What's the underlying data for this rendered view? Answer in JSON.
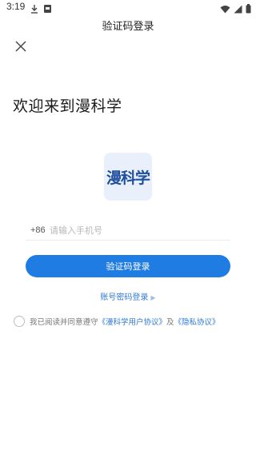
{
  "status_bar": {
    "time": "3:19"
  },
  "header": {
    "title": "验证码登录"
  },
  "welcome": "欢迎来到漫科学",
  "logo": {
    "text": "漫科学"
  },
  "phone": {
    "country_code": "+86",
    "placeholder": "请输入手机号"
  },
  "login_button": "验证码登录",
  "password_login": "账号密码登录",
  "agreement": {
    "prefix": "我已阅读并同意遵守",
    "user_agreement": "《漫科学用户协议》",
    "and": "及",
    "privacy": "《隐私协议》"
  },
  "icons": {
    "close": "close-icon",
    "download": "download-icon",
    "notification": "notification-icon",
    "wifi": "wifi-icon",
    "signal": "signal-icon",
    "battery": "battery-icon",
    "arrow": "chevron-right-icon"
  },
  "colors": {
    "primary": "#1e7ce3",
    "link": "#2f7ad8",
    "logo_bg": "#e9f0fb",
    "logo_text": "#1e4e9e"
  }
}
